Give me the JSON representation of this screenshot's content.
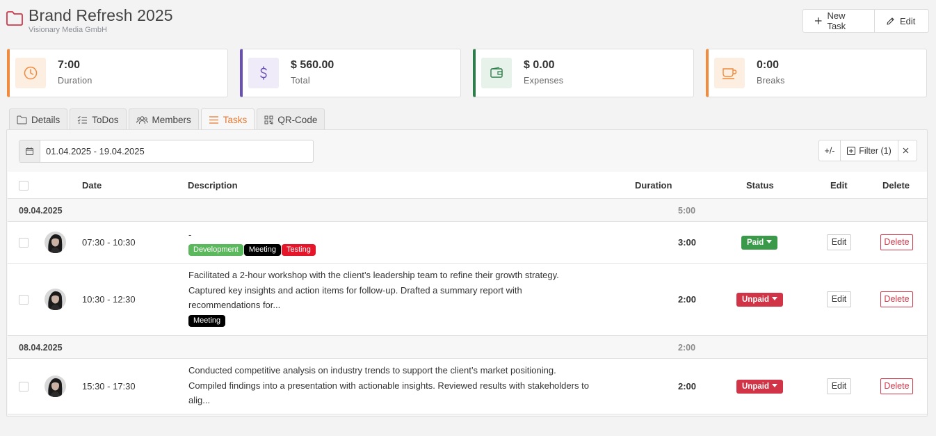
{
  "header": {
    "title": "Brand Refresh 2025",
    "subtitle": "Visionary Media GmbH",
    "new_task_label": "New Task",
    "edit_label": "Edit"
  },
  "stats": [
    {
      "value": "7:00",
      "label": "Duration",
      "icon": "clock-icon",
      "color": "#f08a3c",
      "bg": "#fdeee2"
    },
    {
      "value": "$ 560.00",
      "label": "Total",
      "icon": "dollar-icon",
      "color": "#6a4fb5",
      "bg": "#efebf8"
    },
    {
      "value": "$ 0.00",
      "label": "Expenses",
      "icon": "wallet-icon",
      "color": "#2f7d4a",
      "bg": "#e6f2ea"
    },
    {
      "value": "0:00",
      "label": "Breaks",
      "icon": "coffee-icon",
      "color": "#f08a3c",
      "bg": "#fdeee2"
    }
  ],
  "tabs": [
    {
      "label": "Details",
      "icon": "folder-icon"
    },
    {
      "label": "ToDos",
      "icon": "checklist-icon"
    },
    {
      "label": "Members",
      "icon": "users-icon"
    },
    {
      "label": "Tasks",
      "icon": "list-icon",
      "active": true
    },
    {
      "label": "QR-Code",
      "icon": "qr-code-icon"
    }
  ],
  "filter": {
    "date_range": "01.04.2025 - 19.04.2025",
    "plus_minus_label": "+/-",
    "filter_label": "Filter (1)"
  },
  "table": {
    "columns": {
      "date": "Date",
      "description": "Description",
      "duration": "Duration",
      "status": "Status",
      "edit": "Edit",
      "delete": "Delete"
    },
    "groups": [
      {
        "date": "09.04.2025",
        "total": "5:00",
        "rows": [
          {
            "time": "07:30 - 10:30",
            "description": "-",
            "tags": [
              {
                "label": "Development",
                "color": "#5cb85c"
              },
              {
                "label": "Meeting",
                "color": "#000000"
              },
              {
                "label": "Testing",
                "color": "#e5152a"
              }
            ],
            "duration": "3:00",
            "status": "Paid",
            "status_color": "#3a9a4a",
            "edit_label": "Edit",
            "delete_label": "Delete"
          },
          {
            "time": "10:30 - 12:30",
            "description": "Facilitated a 2-hour workshop with the client’s leadership team to refine their growth strategy. Captured key insights and action items for follow-up. Drafted a summary report with recommendations for...",
            "tags": [
              {
                "label": "Meeting",
                "color": "#000000"
              }
            ],
            "duration": "2:00",
            "status": "Unpaid",
            "status_color": "#d13446",
            "edit_label": "Edit",
            "delete_label": "Delete"
          }
        ]
      },
      {
        "date": "08.04.2025",
        "total": "2:00",
        "rows": [
          {
            "time": "15:30 - 17:30",
            "description": "Conducted competitive analysis on industry trends to support the client’s market positioning. Compiled findings into a presentation with actionable insights. Reviewed results with stakeholders to alig...",
            "tags": [],
            "duration": "2:00",
            "status": "Unpaid",
            "status_color": "#d13446",
            "edit_label": "Edit",
            "delete_label": "Delete"
          }
        ]
      }
    ]
  }
}
